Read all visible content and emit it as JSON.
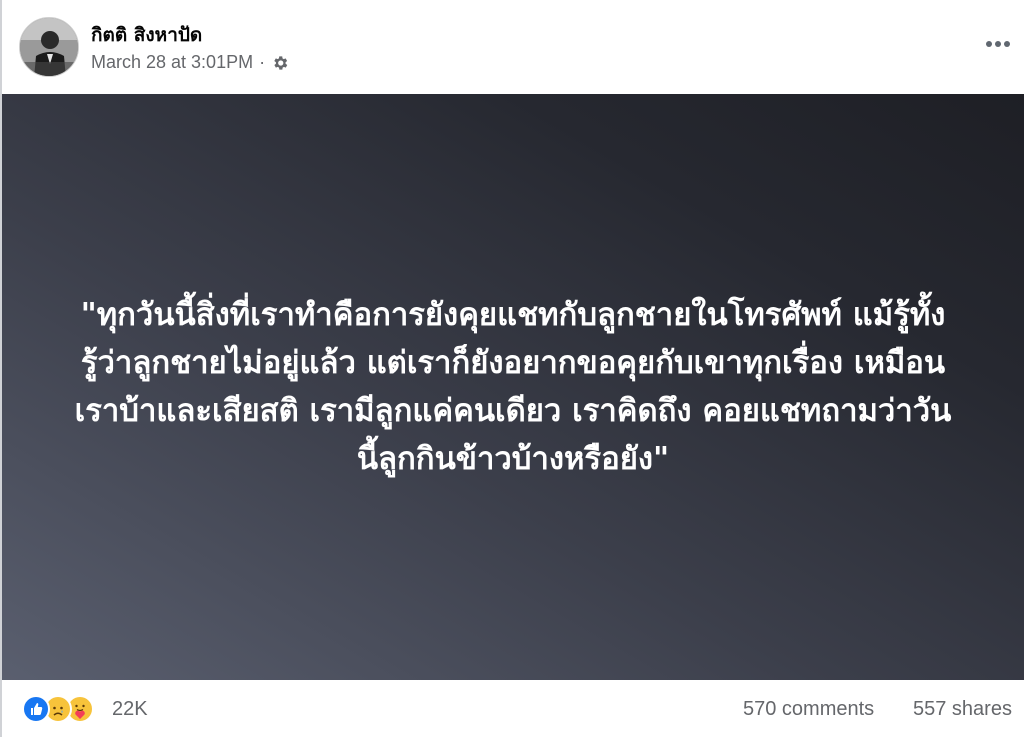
{
  "post": {
    "author": "กิตติ สิงหาปัด",
    "timestamp": "March 28 at 3:01PM",
    "separator": "·",
    "privacy_icon": "gear-icon",
    "more_icon": "more-options-icon"
  },
  "image": {
    "quote_lines": [
      "\"ทุกวันนี้สิ่งที่เราทำคือการยังคุยแชทกับลูกชายในโทรศัพท์ แม้รู้ทั้ง",
      "รู้ว่าลูกชายไม่อยู่แล้ว แต่เราก็ยังอยากขอคุยกับเขาทุกเรื่อง เหมือน",
      "เราบ้าและเสียสติ เรามีลูกแค่คนเดียว เราคิดถึง คอยแชทถามว่าวัน",
      "นี้ลูกกินข้าวบ้างหรือยัง\""
    ]
  },
  "footer": {
    "reactions": [
      "like-icon",
      "sad-icon",
      "care-icon"
    ],
    "reaction_count": "22K",
    "comments": "570 comments",
    "shares": "557 shares"
  },
  "colors": {
    "like": "#1877f2",
    "emoji": "#f7c33b",
    "care_heart": "#f33e58",
    "muted_text": "#65676b"
  }
}
